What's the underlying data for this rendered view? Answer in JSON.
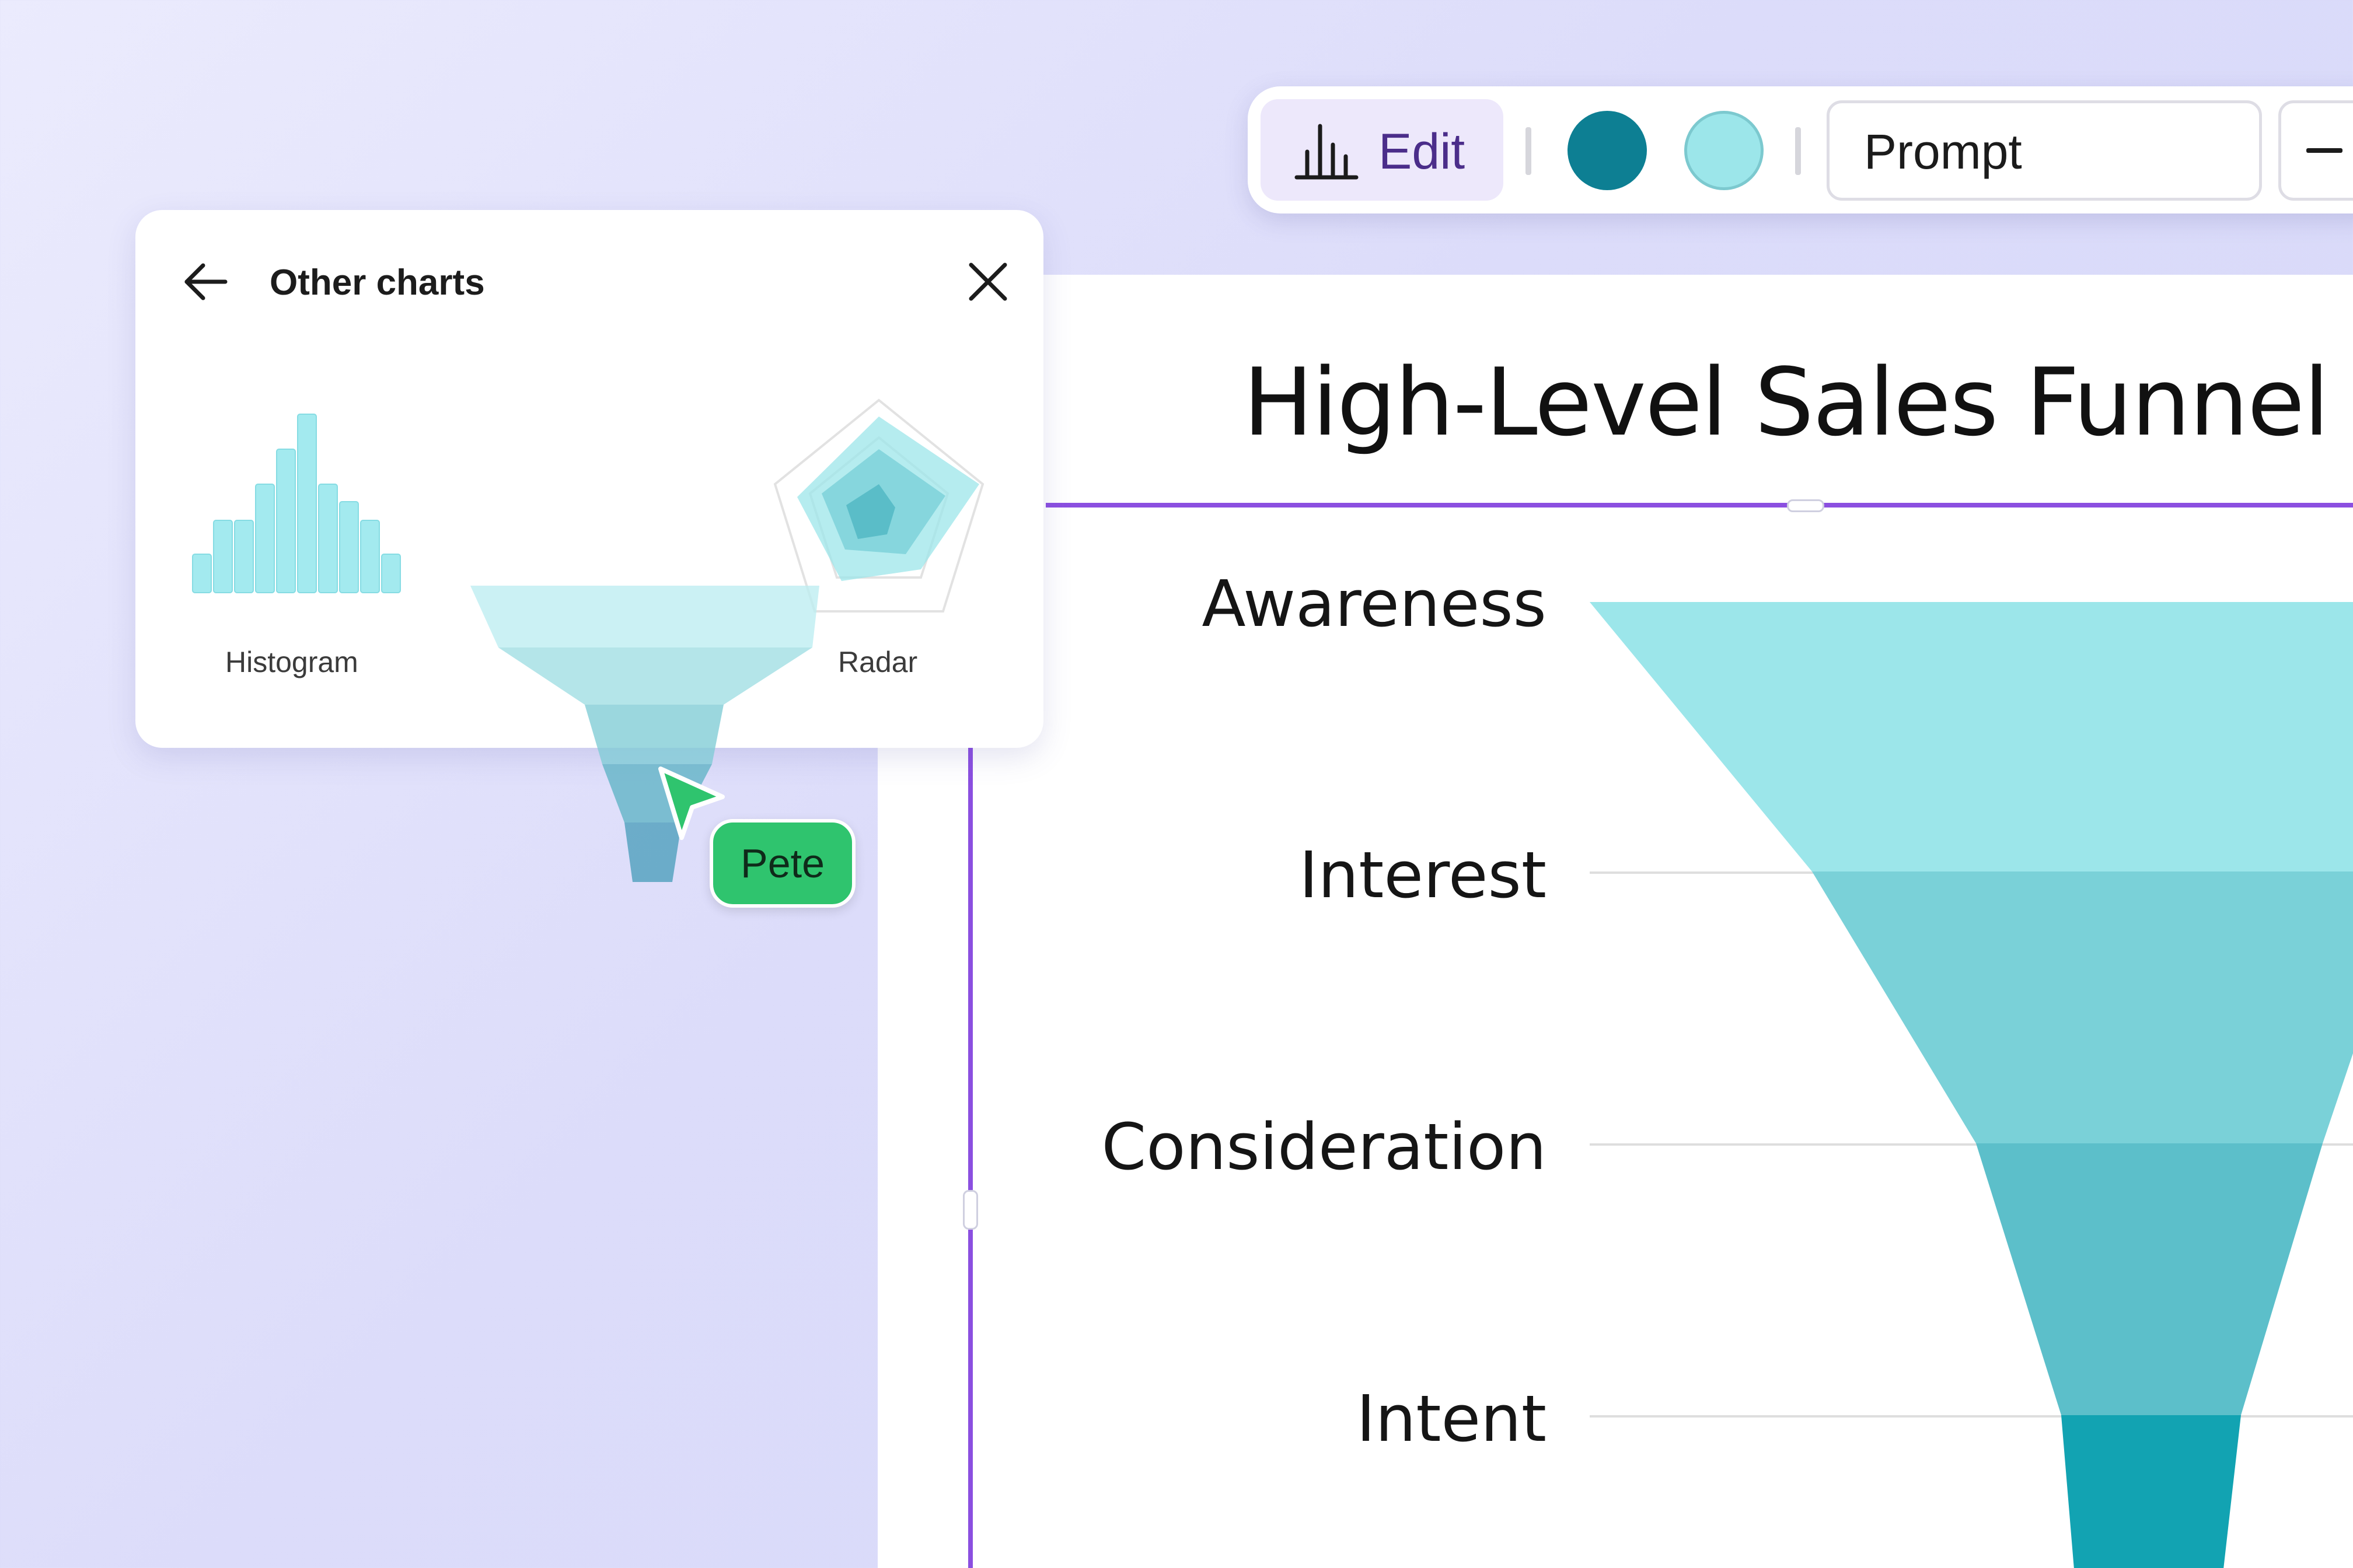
{
  "toolbar": {
    "edit_label": "Edit",
    "prompt_label": "Prompt",
    "swatches": [
      "#0d7f93",
      "#9ce6ea"
    ]
  },
  "panel": {
    "title": "Other charts",
    "charts": [
      {
        "label": "Histogram",
        "icon": "histogram-icon"
      },
      {
        "label": "Radar",
        "icon": "radar-icon"
      }
    ]
  },
  "slide": {
    "title": "High-Level Sales Funnel",
    "stages": [
      "Awareness",
      "Interest",
      "Consideration",
      "Intent"
    ]
  },
  "collaborator": {
    "name": "Pete",
    "color": "#2fc46e"
  },
  "chart_data": {
    "type": "funnel",
    "title": "High-Level Sales Funnel",
    "categories": [
      "Awareness",
      "Interest",
      "Consideration",
      "Intent"
    ],
    "colors": [
      "#9ce6ea",
      "#7ad1d8",
      "#5cbfca",
      "#12a3b2"
    ]
  }
}
